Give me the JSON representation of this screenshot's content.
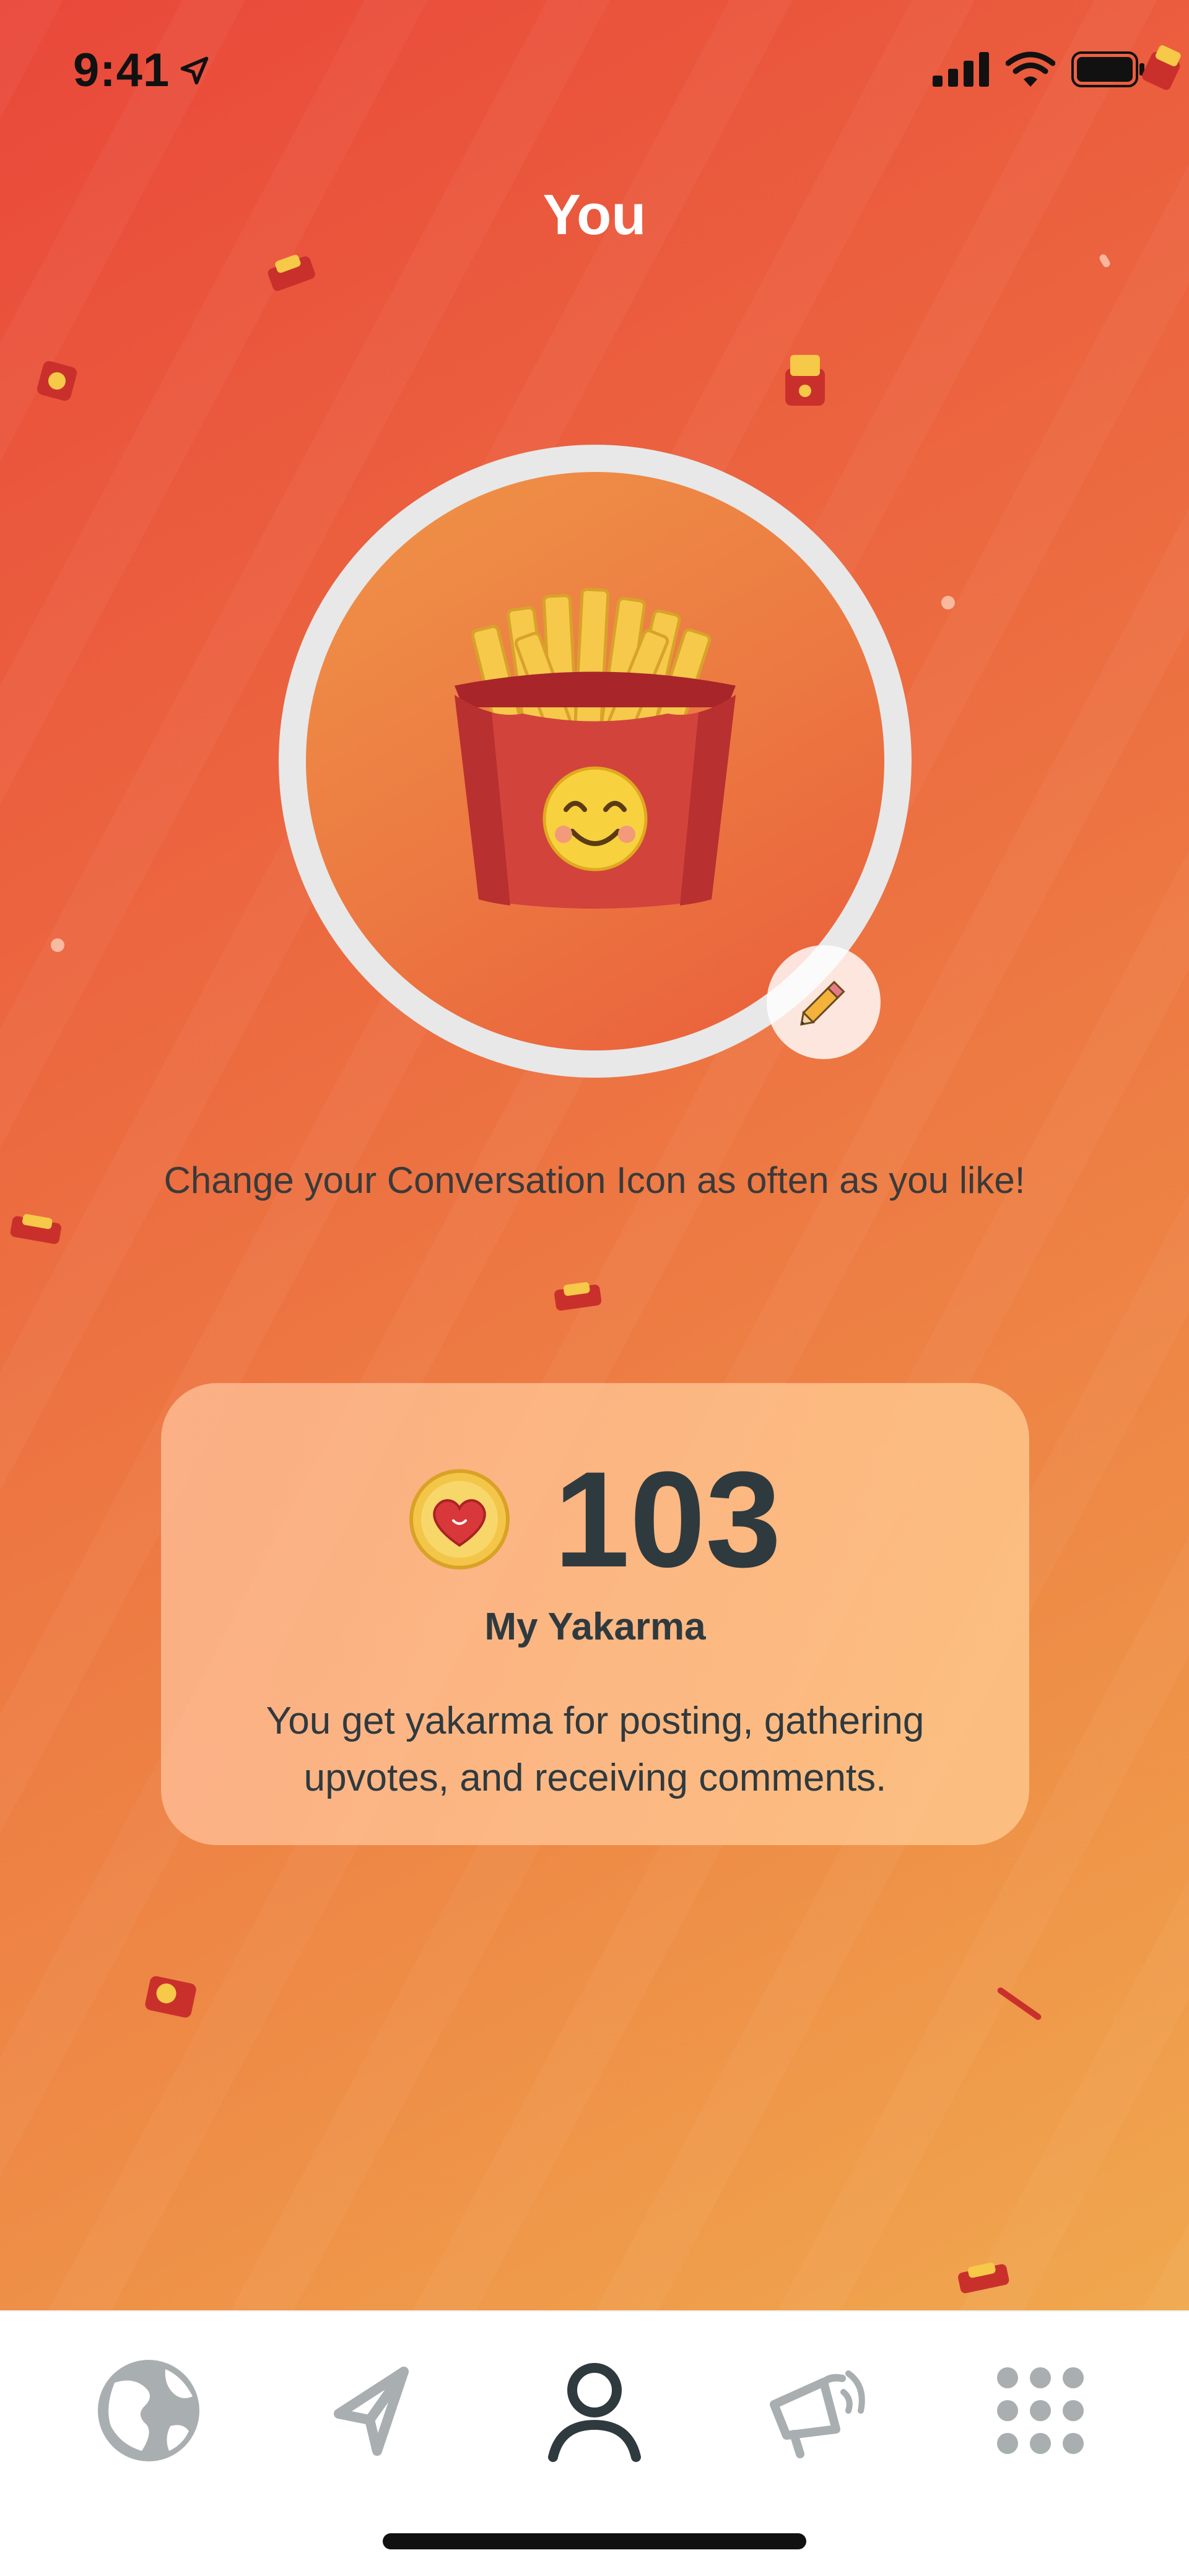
{
  "status_bar": {
    "time": "9:41"
  },
  "header": {
    "title": "You"
  },
  "avatar": {
    "icon": "french-fries-smiling-icon",
    "edit_icon": "pencil-icon"
  },
  "caption": "Change your Conversation Icon as often as you like!",
  "karma": {
    "value": "103",
    "label": "My Yakarma",
    "description": "You get yakarma for posting, gathering upvotes, and receiving comments.",
    "icon": "heart-coin-icon"
  },
  "tabbar": {
    "tabs": [
      {
        "icon": "globe-icon",
        "active": false
      },
      {
        "icon": "paper-plane-icon",
        "active": false
      },
      {
        "icon": "person-icon",
        "active": true
      },
      {
        "icon": "megaphone-icon",
        "active": false
      },
      {
        "icon": "grid-dots-icon",
        "active": false
      }
    ]
  },
  "colors": {
    "gradient_start": "#e9483a",
    "gradient_end": "#f0a84e",
    "text_dark": "#2f3a3f",
    "tab_inactive": "#a9aeb1",
    "tab_active": "#2f3a3f"
  }
}
